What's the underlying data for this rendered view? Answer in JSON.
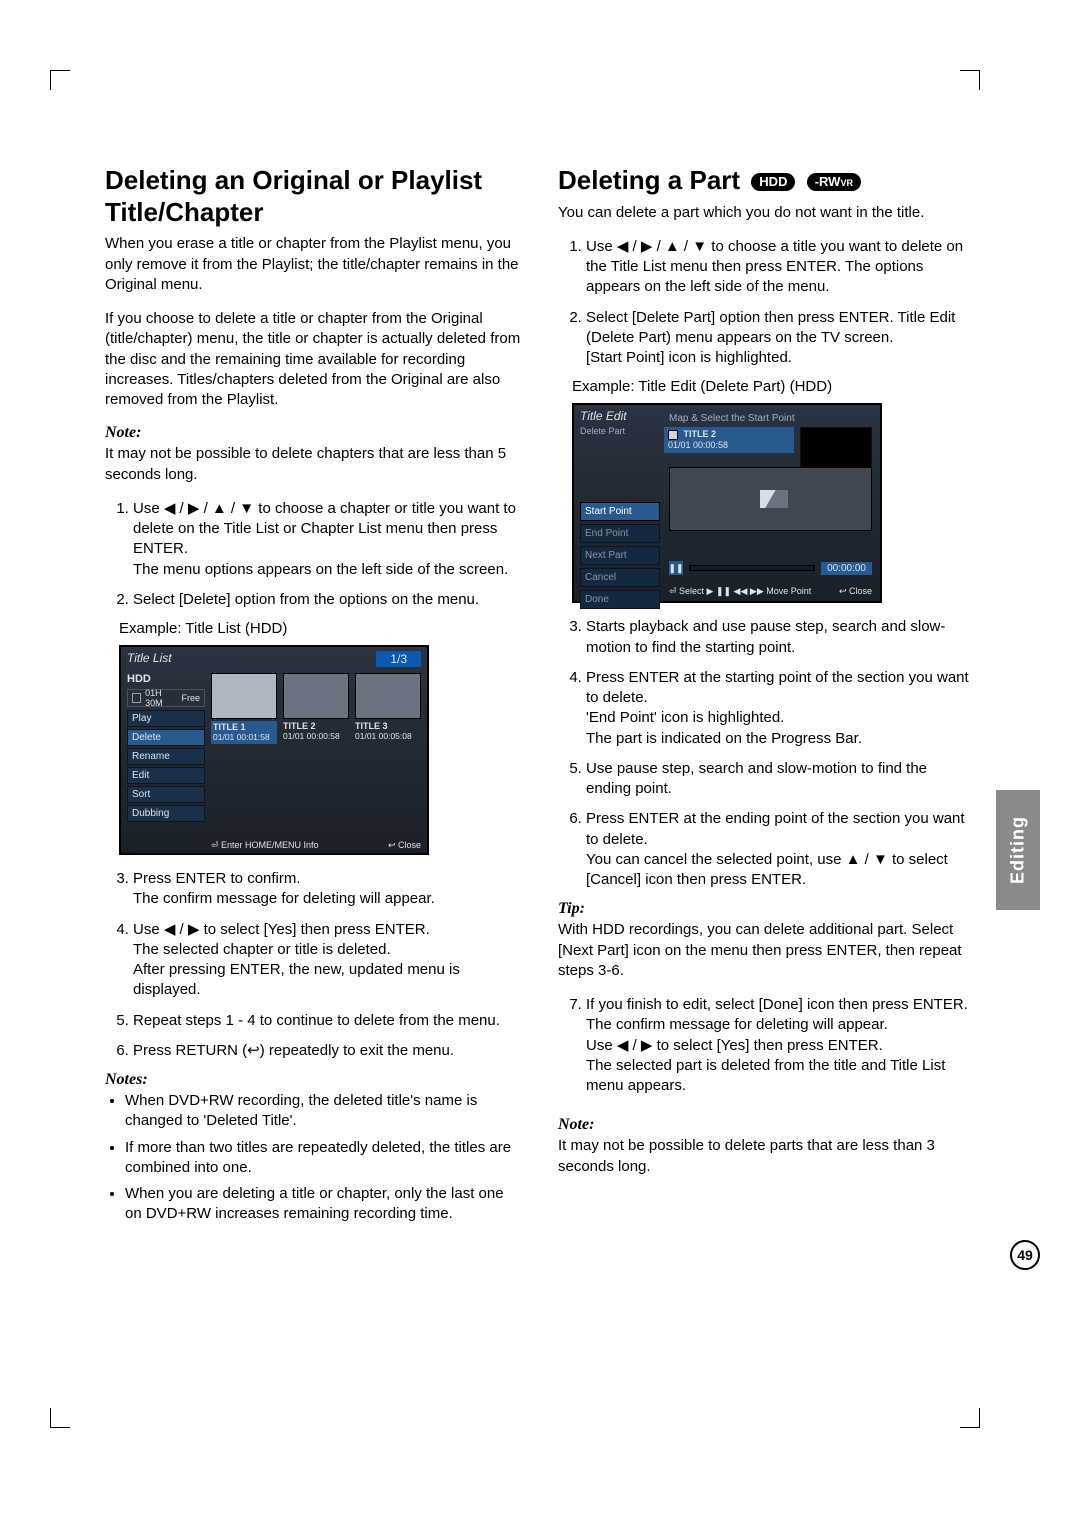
{
  "section_tab": "Editing",
  "page_number": "49",
  "left": {
    "heading": "Deleting an Original or Playlist Title/Chapter",
    "p1": "When you erase a title or chapter from the Playlist menu, you only remove it from the Playlist; the title/chapter remains in the Original menu.",
    "p2": "If you choose to delete a title or chapter from the Original (title/chapter) menu, the title or chapter is actually deleted from the disc and the remaining time available for recording increases. Titles/chapters deleted from the Original are also removed from the Playlist.",
    "note1_h": "Note:",
    "note1_b": "It may not be possible to delete chapters that are less than 5 seconds long.",
    "steps": [
      "Use ◀ / ▶ / ▲ / ▼ to choose a chapter or title you want to delete on the Title List or Chapter List menu then press ENTER.\nThe menu options appears on the left side of the screen.",
      "Select [Delete] option from the options on the menu."
    ],
    "example_cap": "Example: Title List (HDD)",
    "shot": {
      "header": "Title List",
      "pager": "1/3",
      "side_label": "HDD",
      "free_time": "01H 30M",
      "free_text": "Free",
      "menu": [
        "Play",
        "Delete",
        "Rename",
        "Edit",
        "Sort",
        "Dubbing"
      ],
      "thumbs": [
        {
          "title": "TITLE 1",
          "sub": "01/01   00:01:58"
        },
        {
          "title": "TITLE 2",
          "sub": "01/01   00:00:58"
        },
        {
          "title": "TITLE 3",
          "sub": "01/01   00:05:08"
        }
      ],
      "footer_left": "⏎ Enter   HOME/MENU Info",
      "footer_right": "↩ Close"
    },
    "steps2": [
      "Press ENTER to confirm.\nThe confirm message for deleting will appear.",
      "Use ◀ / ▶ to select [Yes] then press ENTER.\nThe selected chapter or title is deleted.\nAfter pressing ENTER, the new, updated menu is displayed.",
      "Repeat steps 1 - 4 to continue to delete from the menu.",
      "Press RETURN (↩) repeatedly to exit the menu."
    ],
    "notes_h": "Notes:",
    "notes": [
      "When DVD+RW recording, the deleted title's name is changed to 'Deleted Title'.",
      "If more than two titles are repeatedly deleted, the titles are combined into one.",
      "When you are deleting a title or chapter, only the last one on DVD+RW increases remaining recording time."
    ]
  },
  "right": {
    "heading": "Deleting a Part",
    "badge1": "HDD",
    "badge2_prefix": "-RW",
    "badge2_suffix": "VR",
    "p1": "You can delete a part which you do not want in the title.",
    "steps_a": [
      "Use ◀ / ▶ / ▲ / ▼ to choose a title you want to delete on the Title List menu then press ENTER. The options appears on the left side of the menu.",
      "Select [Delete Part] option then press ENTER. Title Edit (Delete Part) menu appears on the TV screen.\n[Start Point] icon is highlighted."
    ],
    "example_cap": "Example: Title Edit (Delete Part) (HDD)",
    "shot": {
      "header": "Title Edit",
      "sub": "Delete Part",
      "hint": "Map & Select the Start Point",
      "card_title": "TITLE 2",
      "card_sub": "01/01   00:00:58",
      "menu": [
        "Start Point",
        "End Point",
        "Next Part",
        "Cancel",
        "Done"
      ],
      "time": "00:00:00",
      "footer_left": "⏎ Select   ▶ ❚❚ ◀◀ ▶▶ Move Point",
      "footer_right": "↩ Close"
    },
    "steps_b": [
      "Starts playback and use pause step, search and slow-motion to find the starting point.",
      "Press ENTER at the starting point of the section you want to delete.\n'End Point' icon is highlighted.\nThe part is indicated on the Progress Bar.",
      "Use pause step, search and slow-motion to find the ending point.",
      "Press ENTER at the ending point of the section you want to delete.\nYou can cancel the selected point, use ▲ / ▼ to select [Cancel] icon then press ENTER."
    ],
    "tip_h": "Tip:",
    "tip_b": "With HDD recordings, you can delete additional part. Select [Next Part] icon on the menu then press ENTER, then repeat steps 3-6.",
    "steps_c": [
      "If you finish to edit, select [Done] icon then press ENTER.\nThe confirm message for deleting will appear.\nUse ◀ / ▶ to select [Yes] then press ENTER.\nThe selected part is deleted from the title and Title List menu appears."
    ],
    "note_h": "Note:",
    "note_b": "It may not be possible to delete parts that are less than 3 seconds long."
  }
}
